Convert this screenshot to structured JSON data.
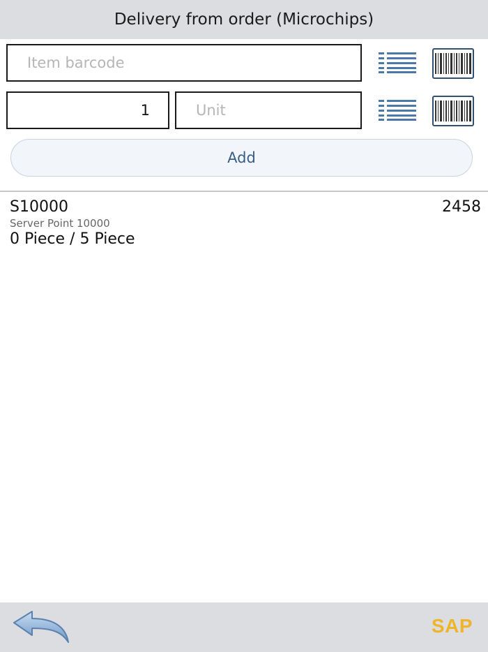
{
  "header": {
    "title": "Delivery from order (Microchips)"
  },
  "form": {
    "barcode": {
      "value": "",
      "placeholder": "Item barcode"
    },
    "quantity": {
      "value": "1",
      "placeholder": ""
    },
    "unit": {
      "value": "",
      "placeholder": "Unit"
    },
    "add_label": "Add"
  },
  "icons": {
    "list": "list-icon",
    "scan": "barcode-scan-icon",
    "back": "back-arrow-icon"
  },
  "items": [
    {
      "code": "S10000",
      "quantity_right": "2458",
      "description": "Server Point 10000",
      "progress": "0 Piece / 5 Piece"
    }
  ],
  "footer": {
    "brand": "SAP"
  },
  "colors": {
    "header_bg": "#dcdde0",
    "accent_blue": "#3a5d86",
    "brand_yellow": "#f0b42a"
  }
}
